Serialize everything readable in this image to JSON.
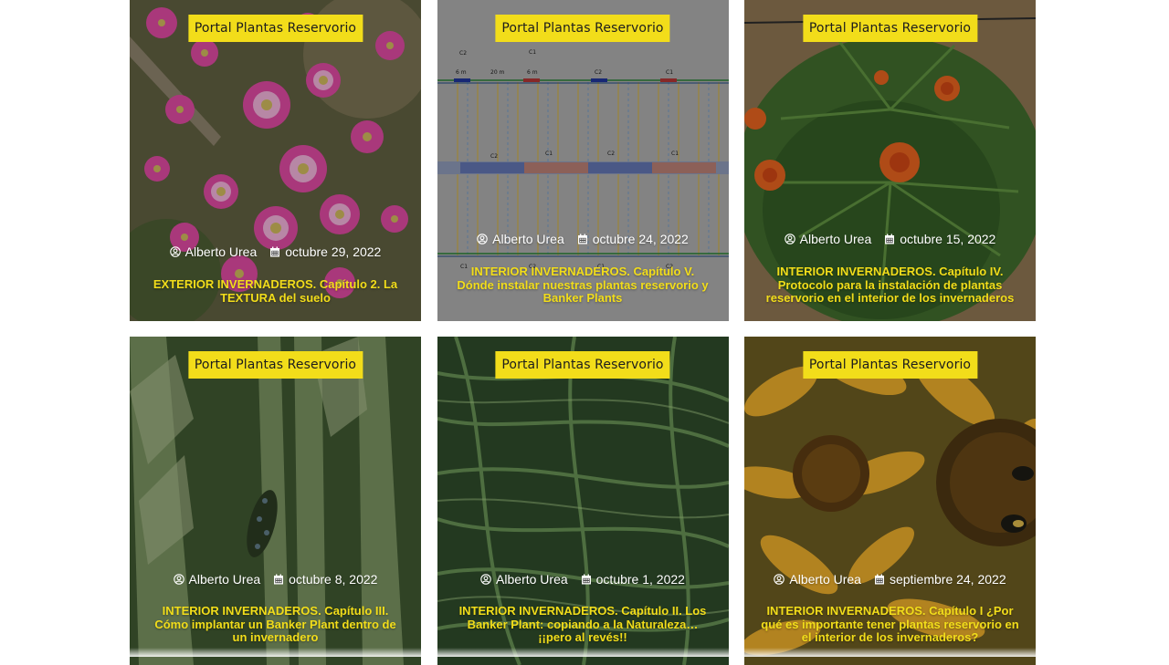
{
  "posts": [
    {
      "category": "Portal Plantas Reservorio",
      "author": "Alberto Urea",
      "date": "octubre 29, 2022",
      "title": "EXTERIOR INVERNADEROS. Capítulo 2. La TEXTURA del suelo",
      "image": "pink-daisy-flowers"
    },
    {
      "category": "Portal Plantas Reservorio",
      "author": "Alberto Urea",
      "date": "octubre 24, 2022",
      "title": "INTERIOR INVERNADEROS. Capítulo V. Dónde instalar nuestras plantas reservorio y Banker Plants",
      "image": "greenhouse-layout-diagram",
      "diagram_labels": [
        "C2",
        "C1",
        "C2",
        "C1",
        "6 m",
        "20 m",
        "6 m",
        "C2",
        "C1",
        "C2",
        "C1",
        "C1",
        "C2",
        "C1",
        "C2"
      ]
    },
    {
      "category": "Portal Plantas Reservorio",
      "author": "Alberto Urea",
      "date": "octubre 15, 2022",
      "title": "INTERIOR INVERNADEROS. Capítulo IV. Protocolo para la instalación de plantas reservorio en el interior de los invernaderos",
      "image": "marigold-plant"
    },
    {
      "category": "Portal Plantas Reservorio",
      "author": "Alberto Urea",
      "date": "octubre 8, 2022",
      "title": "INTERIOR INVERNADEROS. Capítulo III. Cómo implantar un Banker Plant dentro de un invernadero",
      "image": "ladybug-larva-on-wheat"
    },
    {
      "category": "Portal Plantas Reservorio",
      "author": "Alberto Urea",
      "date": "octubre 1, 2022",
      "title": "INTERIOR INVERNADEROS. Capítulo II. Los Banker Plant: copiando a la Naturaleza… ¡¡pero al revés!!",
      "image": "green-grass"
    },
    {
      "category": "Portal Plantas Reservorio",
      "author": "Alberto Urea",
      "date": "septiembre 24, 2022",
      "title": "INTERIOR INVERNADEROS. Capítulo I ¿Por qué es importante tener plantas reservorio en el interior de los invernaderos?",
      "image": "sunflowers-with-bee"
    }
  ],
  "colors": {
    "accent": "#f2dd1a",
    "meta_text": "#ffffff",
    "badge_text": "#1d1d1d"
  },
  "icons": {
    "author": "user-circle-icon",
    "date": "calendar-icon"
  }
}
